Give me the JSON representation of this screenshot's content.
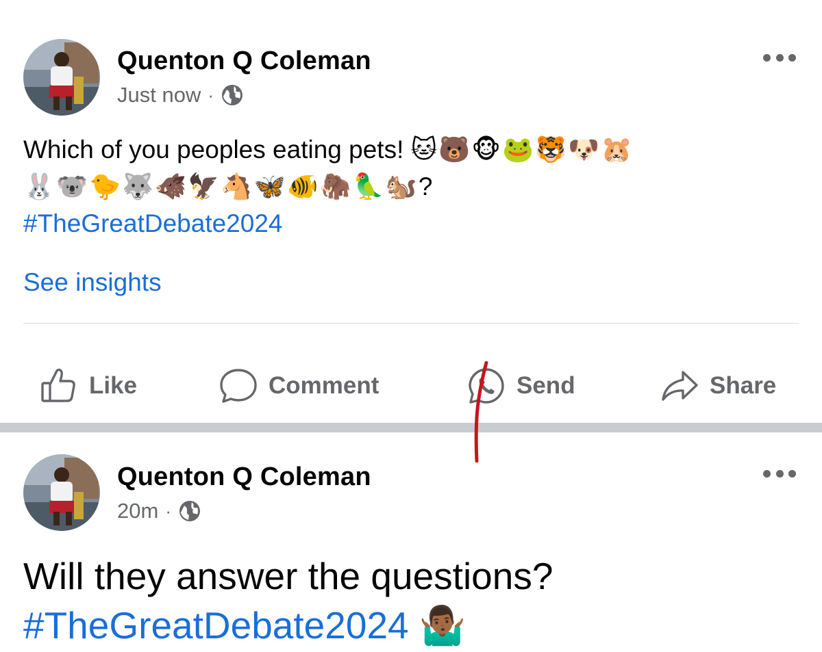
{
  "posts": [
    {
      "author": "Quenton Q Coleman",
      "time": "Just now",
      "separator": "·",
      "privacy_icon": "globe-icon",
      "text": "Which of you peoples eating pets!",
      "emoji_line1": "🐱🐻🐵🐸🐯🐶🐹",
      "emoji_line2": "🐰🐨🐤🐺🐗🦅🐴🦋🐠🦣🦜🐿️",
      "text_end": "?",
      "hashtag": "#TheGreatDebate2024",
      "insights_link": "See insights",
      "actions": {
        "like": "Like",
        "comment": "Comment",
        "send": "Send",
        "share": "Share"
      }
    },
    {
      "author": "Quenton Q Coleman",
      "time": "20m",
      "separator": "·",
      "privacy_icon": "globe-icon",
      "text": "Will they answer the questions?",
      "hashtag": "#TheGreatDebate2024",
      "hashtag_emoji": "🤷🏾‍♂️"
    }
  ],
  "colors": {
    "link_blue": "#1a6ed8",
    "secondary_gray": "#65676b",
    "divider": "#c9ccd1",
    "annotation_red": "#c8141e"
  }
}
